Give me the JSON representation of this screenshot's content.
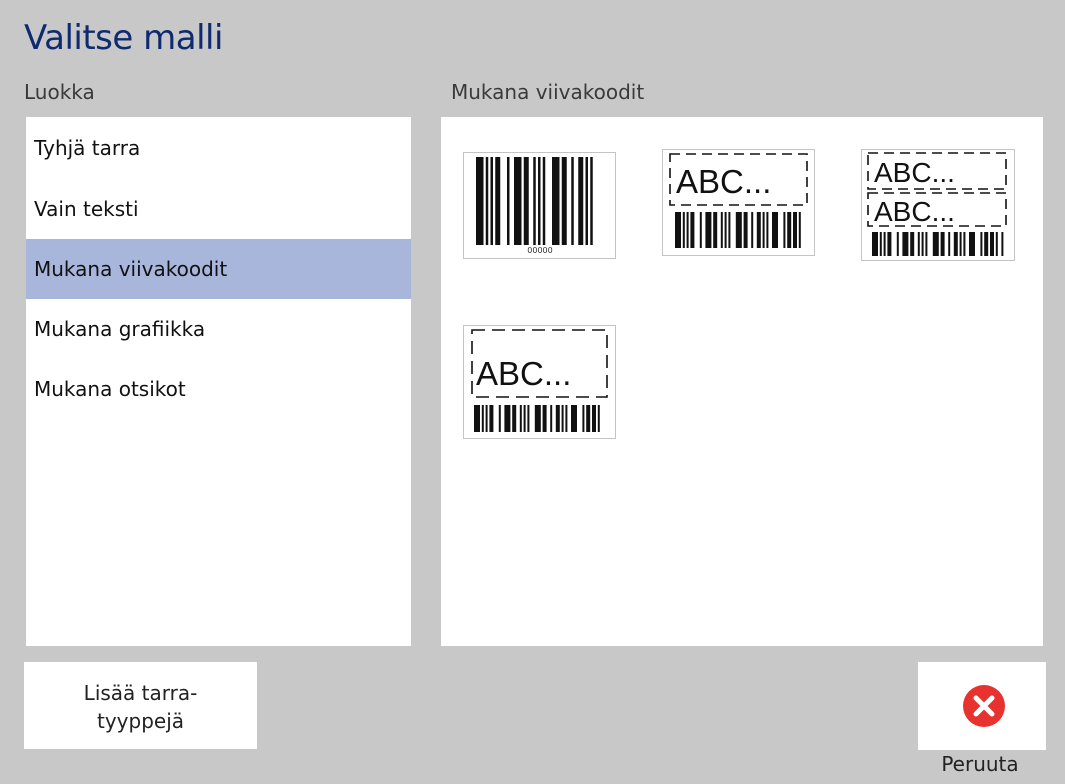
{
  "header": {
    "title": "Valitse malli"
  },
  "categories": {
    "label": "Luokka",
    "items": [
      {
        "label": "Tyhjä tarra"
      },
      {
        "label": "Vain teksti"
      },
      {
        "label": "Mukana viivakoodit",
        "selected": true
      },
      {
        "label": "Mukana grafiikka"
      },
      {
        "label": "Mukana otsikot"
      }
    ]
  },
  "templates": {
    "label": "Mukana viivakoodit",
    "items": [
      {
        "kind": "barcode-only",
        "caption": "00000"
      },
      {
        "kind": "text-over-barcode",
        "text": "ABC..."
      },
      {
        "kind": "two-text-over-barcode",
        "text": "ABC..."
      },
      {
        "kind": "tall-text-over-barcode",
        "text": "ABC..."
      }
    ]
  },
  "footer": {
    "add_label_line1": "Lisää tarra-",
    "add_label_line2": "tyyppejä",
    "cancel_label": "Peruuta",
    "cancel_icon": "close-icon"
  },
  "colors": {
    "selection": "#a9b6dc",
    "title": "#0f2a6e",
    "cancel": "#e8322f"
  }
}
